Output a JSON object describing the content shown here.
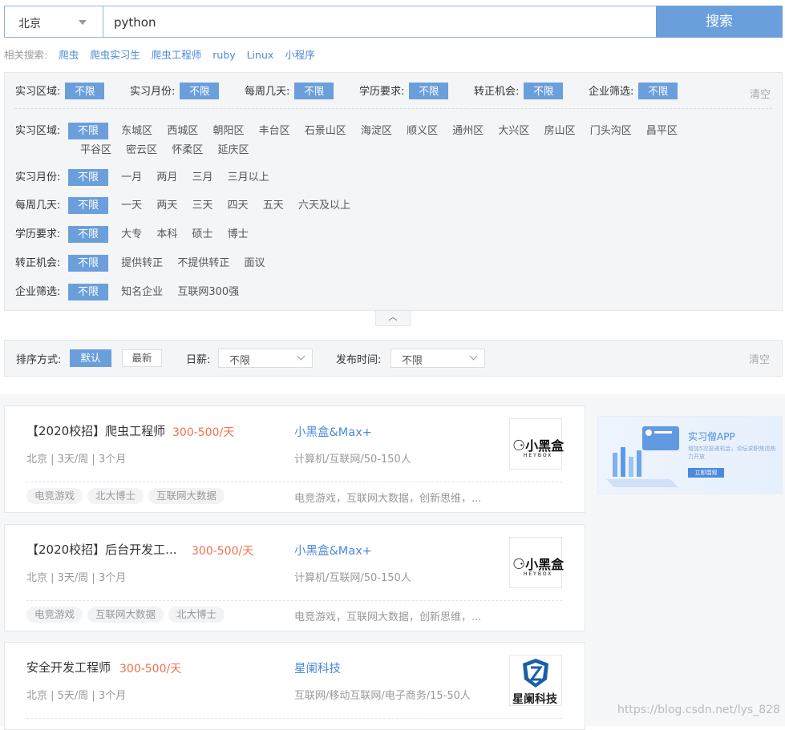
{
  "search": {
    "city": "北京",
    "query": "python",
    "button": "搜索"
  },
  "related": {
    "label": "相关搜索:",
    "items": [
      "爬虫",
      "爬虫实习生",
      "爬虫工程师",
      "ruby",
      "Linux",
      "小程序"
    ]
  },
  "selected": {
    "items": [
      {
        "label": "实习区域:",
        "value": "不限"
      },
      {
        "label": "实习月份:",
        "value": "不限"
      },
      {
        "label": "每周几天:",
        "value": "不限"
      },
      {
        "label": "学历要求:",
        "value": "不限"
      },
      {
        "label": "转正机会:",
        "value": "不限"
      },
      {
        "label": "企业筛选:",
        "value": "不限"
      }
    ],
    "clear": "清空"
  },
  "filters": {
    "area": {
      "label": "实习区域:",
      "active": "不限",
      "row1": [
        "东城区",
        "西城区",
        "朝阳区",
        "丰台区",
        "石景山区",
        "海淀区",
        "顺义区",
        "通州区",
        "大兴区",
        "房山区",
        "门头沟区",
        "昌平区"
      ],
      "row2": [
        "平谷区",
        "密云区",
        "怀柔区",
        "延庆区"
      ]
    },
    "months": {
      "label": "实习月份:",
      "active": "不限",
      "options": [
        "一月",
        "两月",
        "三月",
        "三月以上"
      ]
    },
    "days": {
      "label": "每周几天:",
      "active": "不限",
      "options": [
        "一天",
        "两天",
        "三天",
        "四天",
        "五天",
        "六天及以上"
      ]
    },
    "edu": {
      "label": "学历要求:",
      "active": "不限",
      "options": [
        "大专",
        "本科",
        "硕士",
        "博士"
      ]
    },
    "regular": {
      "label": "转正机会:",
      "active": "不限",
      "options": [
        "提供转正",
        "不提供转正",
        "面议"
      ]
    },
    "company": {
      "label": "企业筛选:",
      "active": "不限",
      "options": [
        "知名企业",
        "互联网300强"
      ]
    }
  },
  "sort": {
    "label": "排序方式:",
    "default": "默认",
    "newest": "最新",
    "pay_label": "日薪:",
    "pay_value": "不限",
    "time_label": "发布时间:",
    "time_value": "不限",
    "clear": "清空"
  },
  "jobs": [
    {
      "title": "【2020校招】爬虫工程师",
      "salary": "300-500/天",
      "meta": "北京 | 3天/周 | 3个月",
      "company": "小黑盒&Max+",
      "company_info": "计算机/互联网/50-150人",
      "tags": [
        "电竞游戏",
        "北大博士",
        "互联网大数据"
      ],
      "company_tags": "电竞游戏，互联网大数据，创新思维，...",
      "logo": {
        "name": "小黑盒",
        "sub": "HEYBOX"
      }
    },
    {
      "title": "【2020校招】后台开发工...",
      "salary": "300-500/天",
      "meta": "北京 | 3天/周 | 3个月",
      "company": "小黑盒&Max+",
      "company_info": "计算机/互联网/50-150人",
      "tags": [
        "电竞游戏",
        "互联网大数据",
        "北大博士"
      ],
      "company_tags": "电竞游戏，互联网大数据，创新思维，...",
      "logo": {
        "name": "小黑盒",
        "sub": "HEYBOX"
      }
    },
    {
      "title": "安全开发工程师",
      "salary": "300-500/天",
      "meta": "北京 | 5天/周 | 3个月",
      "company": "星阑科技",
      "company_info": "互联网/移动互联网/电子商务/15-50人",
      "tags": [],
      "company_tags": "",
      "logo": {
        "name": "星阑科技",
        "sub": ""
      }
    }
  ],
  "ad": {
    "title": "实习僧APP",
    "desc": "增加5次投递机会，论坛求职焦虑热力开放",
    "button": "立即围观"
  },
  "watermark": "https://blog.csdn.net/lys_828",
  "colors": {
    "accent": "#6b9fdc",
    "link": "#4a89dc",
    "salary": "#f0714e"
  }
}
